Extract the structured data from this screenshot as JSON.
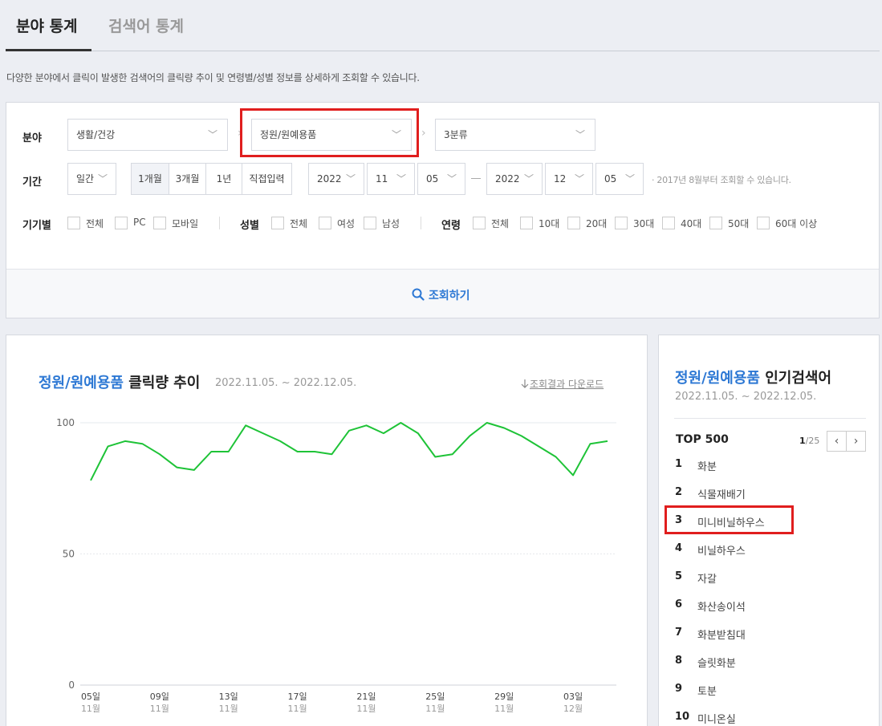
{
  "tabs": {
    "active": "분야 통계",
    "inactive": "검색어 통계"
  },
  "description": "다양한 분야에서 클릭이 발생한 검색어의 클릭량 추이 및 연령별/성별 정보를 상세하게 조회할 수 있습니다.",
  "filters": {
    "category_label": "분야",
    "category1": "생활/건강",
    "category2": "정원/원예용품",
    "category3": "3분류",
    "period_label": "기간",
    "period_unit": "일간",
    "period_buttons": [
      "1개월",
      "3개월",
      "1년",
      "직접입력"
    ],
    "start_year": "2022",
    "start_month": "11",
    "start_day": "05",
    "end_year": "2022",
    "end_month": "12",
    "end_day": "05",
    "period_note": "· 2017년 8월부터 조회할 수 있습니다.",
    "device_label": "기기별",
    "device_options": [
      "전체",
      "PC",
      "모바일"
    ],
    "gender_label": "성별",
    "gender_options": [
      "전체",
      "여성",
      "남성"
    ],
    "age_label": "연령",
    "age_options": [
      "전체",
      "10대",
      "20대",
      "30대",
      "40대",
      "50대",
      "60대 이상"
    ],
    "search_button": "조회하기"
  },
  "chart_panel": {
    "title_highlight": "정원/원예용품",
    "title_rest": " 클릭량 추이",
    "range": "2022.11.05. ~ 2022.12.05.",
    "download": "조회결과 다운로드",
    "download_icon": "download-arrow-icon"
  },
  "chart_data": {
    "type": "line",
    "x": [
      "2022-11-05",
      "2022-11-06",
      "2022-11-07",
      "2022-11-08",
      "2022-11-09",
      "2022-11-10",
      "2022-11-11",
      "2022-11-12",
      "2022-11-13",
      "2022-11-14",
      "2022-11-15",
      "2022-11-16",
      "2022-11-17",
      "2022-11-18",
      "2022-11-19",
      "2022-11-20",
      "2022-11-21",
      "2022-11-22",
      "2022-11-23",
      "2022-11-24",
      "2022-11-25",
      "2022-11-26",
      "2022-11-27",
      "2022-11-28",
      "2022-11-29",
      "2022-11-30",
      "2022-12-01",
      "2022-12-02",
      "2022-12-03",
      "2022-12-04",
      "2022-12-05"
    ],
    "series": [
      {
        "values": [
          78,
          91,
          93,
          92,
          88,
          83,
          82,
          89,
          89,
          99,
          96,
          93,
          89,
          89,
          88,
          97,
          99,
          96,
          100,
          96,
          87,
          88,
          95,
          100,
          98,
          95,
          91,
          87,
          80,
          92,
          93
        ]
      }
    ],
    "ylim": [
      0,
      100
    ],
    "yticks": [
      "0",
      "50",
      "100"
    ],
    "tick_labels": [
      {
        "day": "05일",
        "month": "11월"
      },
      {
        "day": "09일",
        "month": "11월"
      },
      {
        "day": "13일",
        "month": "11월"
      },
      {
        "day": "17일",
        "month": "11월"
      },
      {
        "day": "21일",
        "month": "11월"
      },
      {
        "day": "25일",
        "month": "11월"
      },
      {
        "day": "29일",
        "month": "11월"
      },
      {
        "day": "03일",
        "month": "12월"
      }
    ],
    "line_color": "#1ec337",
    "grid": true
  },
  "rank_panel": {
    "title_highlight": "정원/원예용품",
    "title_rest": " 인기검색어",
    "range": "2022.11.05. ~ 2022.12.05.",
    "top_label": "TOP 500",
    "page_current": "1",
    "page_total": "/25",
    "items": [
      {
        "rank": "1",
        "keyword": "화분"
      },
      {
        "rank": "2",
        "keyword": "식물재배기"
      },
      {
        "rank": "3",
        "keyword": "미니비닐하우스"
      },
      {
        "rank": "4",
        "keyword": "비닐하우스"
      },
      {
        "rank": "5",
        "keyword": "자갈"
      },
      {
        "rank": "6",
        "keyword": "화산송이석"
      },
      {
        "rank": "7",
        "keyword": "화분받침대"
      },
      {
        "rank": "8",
        "keyword": "슬릿화분"
      },
      {
        "rank": "9",
        "keyword": "토분"
      },
      {
        "rank": "10",
        "keyword": "미니온실"
      }
    ]
  },
  "colors": {
    "accent": "#2d78d4",
    "highlight_box": "#e01e1e"
  }
}
